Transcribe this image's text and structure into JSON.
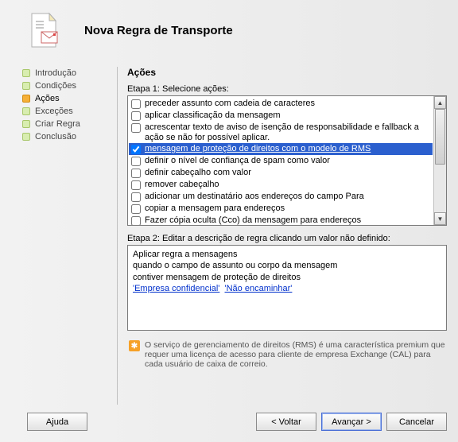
{
  "header": {
    "title": "Nova Regra de Transporte"
  },
  "sidebar": {
    "items": [
      {
        "label": "Introdução",
        "active": false
      },
      {
        "label": "Condições",
        "active": false
      },
      {
        "label": "Ações",
        "active": true
      },
      {
        "label": "Exceções",
        "active": false
      },
      {
        "label": "Criar Regra",
        "active": false
      },
      {
        "label": "Conclusão",
        "active": false
      }
    ]
  },
  "main": {
    "heading": "Ações",
    "step1_label": "Etapa 1: Selecione ações:",
    "actions": [
      {
        "label": "preceder assunto com cadeia de caracteres",
        "checked": false,
        "selected": false
      },
      {
        "label": "aplicar classificação da mensagem",
        "checked": false,
        "selected": false
      },
      {
        "label": "acrescentar texto de aviso de isenção de responsabilidade e fallback a ação se não for possível aplicar.",
        "checked": false,
        "selected": false
      },
      {
        "label": "mensagem de proteção de direitos com o modelo de RMS",
        "checked": true,
        "selected": true
      },
      {
        "label": "definir o nível de confiança de spam como valor",
        "checked": false,
        "selected": false
      },
      {
        "label": "definir cabeçalho com valor",
        "checked": false,
        "selected": false
      },
      {
        "label": "remover cabeçalho",
        "checked": false,
        "selected": false
      },
      {
        "label": "adicionar um destinatário aos endereços do campo Para",
        "checked": false,
        "selected": false
      },
      {
        "label": "copiar a mensagem para endereços",
        "checked": false,
        "selected": false
      },
      {
        "label": "Fazer cópia oculta (Cco) da mensagem para endereços",
        "checked": false,
        "selected": false
      }
    ],
    "step2_label": "Etapa 2: Editar a descrição de regra clicando um valor não definido:",
    "description": {
      "line1": "Aplicar regra a mensagens",
      "line2a": "quando o campo de assunto ou corpo da mensagem",
      "line2b": "contiver mensagem de proteção de direitos",
      "link1": "'Empresa confidencial'",
      "link2": "'Não encaminhar'"
    },
    "info_text": "O serviço de gerenciamento de direitos (RMS) é uma característica premium que requer uma licença de acesso para cliente de empresa Exchange (CAL) para cada usuário de caixa de correio."
  },
  "footer": {
    "help": "Ajuda",
    "back": "< Voltar",
    "next": "Avançar >",
    "cancel": "Cancelar"
  }
}
